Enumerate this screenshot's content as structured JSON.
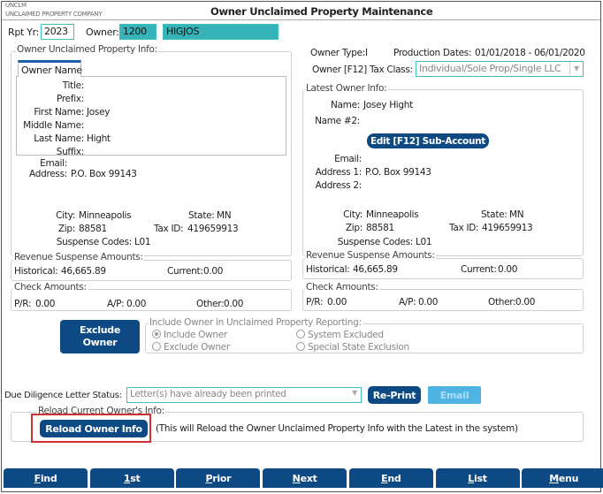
{
  "header": {
    "app_code": "UNCLM",
    "company": "UNCLAIMED PROPERTY COMPANY",
    "title": "Owner Unclaimed Property Maintenance"
  },
  "top": {
    "rpt_yr_label": "Rpt Yr:",
    "rpt_yr": "2023",
    "owner_label": "Owner:",
    "owner_id": "1200",
    "owner_code": "HIGJOS"
  },
  "left": {
    "group_label": "Owner Unclaimed Property Info:",
    "tab": "Owner Name",
    "fields": [
      {
        "label": "Title:",
        "value": ""
      },
      {
        "label": "Prefix:",
        "value": ""
      },
      {
        "label": "First Name:",
        "value": "Josey"
      },
      {
        "label": "Middle Name:",
        "value": ""
      },
      {
        "label": "Last Name:",
        "value": "Hight"
      },
      {
        "label": "Suffix:",
        "value": ""
      }
    ],
    "email_label": "Email:",
    "address_label": "Address:",
    "address": "P.O. Box 99143",
    "city_label": "City:",
    "city": "Minneapolis",
    "state_label": "State:",
    "state": "MN",
    "zip_label": "Zip:",
    "zip": "88581",
    "taxid_label": "Tax ID:",
    "taxid": "419659913",
    "suspense_label": "Suspense Codes:",
    "suspense": "L01",
    "revenue_label": "Revenue Suspense Amounts:",
    "historical_label": "Historical:",
    "historical": "46,665.89",
    "current_label": "Current:",
    "current": "0.00",
    "check_label": "Check Amounts:",
    "pr_label": "P/R:",
    "pr": "0.00",
    "ap_label": "A/P:",
    "ap": "0.00",
    "other_label": "Other:",
    "other": "0.00"
  },
  "right": {
    "owner_type_label": "Owner Type:",
    "owner_type": "I",
    "production_label": "Production Dates:",
    "production": "01/01/2018 - 06/01/2020",
    "tax_class_label": "Owner [F12] Tax Class:",
    "tax_class": "Individual/Sole Prop/Single LLC",
    "group_label": "Latest Owner Info:",
    "name_label": "Name:",
    "name": "Josey Hight",
    "name2_label": "Name #2:",
    "edit_button": "Edit [F12] Sub-Account",
    "email_label": "Email:",
    "address1_label": "Address 1:",
    "address1": "P.O. Box 99143",
    "address2_label": "Address 2:",
    "city_label": "City:",
    "city": "Minneapolis",
    "state_label": "State:",
    "state": "MN",
    "zip_label": "Zip:",
    "zip": "88581",
    "taxid_label": "Tax ID:",
    "taxid": "419659913",
    "suspense_label": "Suspense Codes:",
    "suspense": "L01",
    "revenue_label": "Revenue Suspense Amounts:",
    "historical_label": "Historical:",
    "historical": "46,665.89",
    "current_label": "Current:",
    "current": "0.00",
    "check_label": "Check Amounts:",
    "pr_label": "P/R:",
    "pr": "0.00",
    "ap_label": "A/P:",
    "ap": "0.00",
    "other_label": "Other:",
    "other": "0.00"
  },
  "exclude": {
    "button": "Exclude Owner",
    "group_label": "Include Owner in Unclaimed Property Reporting:",
    "options": [
      "Include Owner",
      "Exclude Owner",
      "System Excluded",
      "Special State Exclusion"
    ],
    "selected": "Include Owner"
  },
  "due": {
    "label": "Due Diligence Letter Status:",
    "value": "Letter(s) have already been printed",
    "reprint": "Re-Print",
    "email": "Email"
  },
  "reload": {
    "group_label": "Reload Current Owner's Info:",
    "button": "Reload Owner Info",
    "note": "(This will Reload the Owner Unclaimed Property Info with the Latest in the system)"
  },
  "nav": [
    {
      "key": "F",
      "rest": "ind"
    },
    {
      "key": "1",
      "rest": "st"
    },
    {
      "key": "P",
      "rest": "rior"
    },
    {
      "key": "N",
      "rest": "ext"
    },
    {
      "key": "E",
      "rest": "nd"
    },
    {
      "key": "L",
      "rest": "ist"
    },
    {
      "key": "M",
      "rest": "enu"
    }
  ],
  "colors": {
    "accent": "#0d4a84",
    "teal": "#35b3b8",
    "highlight": "#d03030"
  }
}
